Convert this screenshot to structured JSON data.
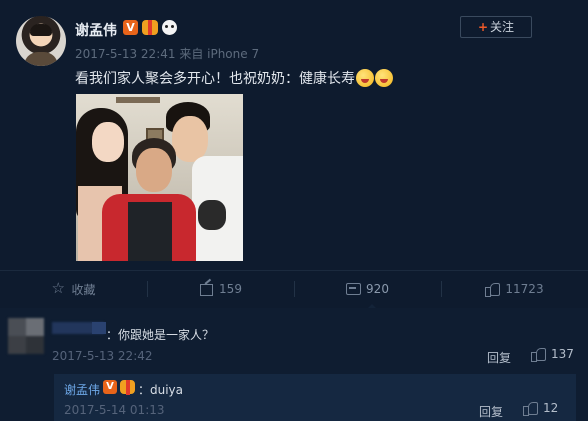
{
  "post": {
    "author": "谢孟伟",
    "badges": {
      "verified": "V",
      "badge_colors": {
        "verified": "#e8641a",
        "gift": "#f0a020",
        "panda": "#f4f4f4"
      }
    },
    "meta": "2017-5-13 22:41 来自 iPhone 7",
    "follow_button": {
      "plus": "+",
      "label": "关注"
    },
    "text": "看我们家人聚会多开心！也祝奶奶：健康长寿",
    "emojis": [
      "smile-emoji-icon",
      "kiss-emoji-icon"
    ],
    "photo": {
      "icon": "family-photo-image"
    }
  },
  "actions": {
    "favorite": {
      "label": "收藏",
      "icon": "star-icon"
    },
    "repost": {
      "count": "159",
      "icon": "share-icon"
    },
    "comment": {
      "count": "920",
      "icon": "comment-icon"
    },
    "like": {
      "count": "11723",
      "icon": "thumbs-up-icon"
    }
  },
  "comments": [
    {
      "text": "：你跟她是一家人？",
      "time": "2017-5-13 22:42",
      "reply_label": "回复",
      "likes": "137",
      "replies": [
        {
          "author": "谢孟伟",
          "text": "：duiya",
          "time": "2017-5-14 01:13",
          "reply_label": "回复",
          "likes": "12"
        }
      ]
    }
  ],
  "colors": {
    "background": "#0e1b2e",
    "link": "#6ea8e8",
    "accent": "#f05a28"
  }
}
